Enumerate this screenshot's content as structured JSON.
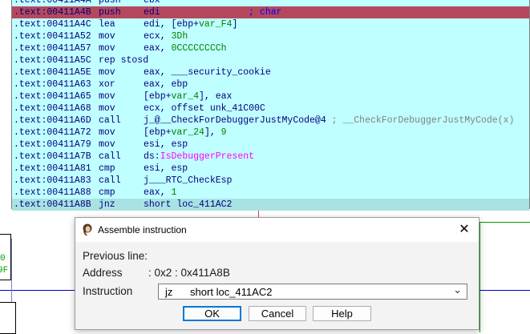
{
  "code": {
    "lines": [
      {
        "addr": ".text:00411A4A",
        "mn": "push",
        "ops": "ebx",
        "comment": "",
        "state": "normal"
      },
      {
        "addr": ".text:00411A4B",
        "mn": "push",
        "ops": "edi",
        "comment": "; char",
        "state": "selected"
      },
      {
        "addr": ".text:00411A4C",
        "mn": "lea",
        "ops_pre": "edi, [ebp+",
        "ops_var": "var_F4",
        "ops_post": "]",
        "state": "normal",
        "kind": "var"
      },
      {
        "addr": ".text:00411A52",
        "mn": "mov",
        "ops_pre": "ecx, ",
        "ops_imm": "3Dh",
        "state": "normal",
        "kind": "imm"
      },
      {
        "addr": ".text:00411A57",
        "mn": "mov",
        "ops_pre": "eax, ",
        "ops_imm": "0CCCCCCCCh",
        "state": "normal",
        "kind": "imm"
      },
      {
        "addr": ".text:00411A5C",
        "mn": "rep stosd",
        "ops": "",
        "state": "normal"
      },
      {
        "addr": ".text:00411A5E",
        "mn": "mov",
        "ops": "eax, ___security_cookie",
        "state": "normal"
      },
      {
        "addr": ".text:00411A63",
        "mn": "xor",
        "ops": "eax, ebp",
        "state": "normal"
      },
      {
        "addr": ".text:00411A65",
        "mn": "mov",
        "ops_pre": "[ebp+",
        "ops_var": "var_4",
        "ops_post": "], eax",
        "state": "normal",
        "kind": "var"
      },
      {
        "addr": ".text:00411A68",
        "mn": "mov",
        "ops": "ecx, offset unk_41C00C",
        "state": "normal"
      },
      {
        "addr": ".text:00411A6D",
        "mn": "call",
        "ops": "j_@__CheckForDebuggerJustMyCode@4",
        "comment": "; __CheckForDebuggerJustMyCode(x)",
        "state": "normal"
      },
      {
        "addr": ".text:00411A72",
        "mn": "mov",
        "ops_pre": "[ebp+",
        "ops_var": "var_24",
        "ops_post": "], ",
        "ops_imm": "9",
        "state": "normal",
        "kind": "varimm"
      },
      {
        "addr": ".text:00411A79",
        "mn": "mov",
        "ops": "esi, esp",
        "state": "normal"
      },
      {
        "addr": ".text:00411A7B",
        "mn": "call",
        "ops_pre": "ds:",
        "ops_fn": "IsDebuggerPresent",
        "state": "normal",
        "kind": "fn"
      },
      {
        "addr": ".text:00411A81",
        "mn": "cmp",
        "ops": "esi, esp",
        "state": "normal"
      },
      {
        "addr": ".text:00411A83",
        "mn": "call",
        "ops": "j___RTC_CheckEsp",
        "state": "normal"
      },
      {
        "addr": ".text:00411A88",
        "mn": "cmp",
        "ops_pre": "eax, ",
        "ops_imm": "1",
        "state": "normal",
        "kind": "imm"
      },
      {
        "addr": ".text:00411A8B",
        "mn": "jnz",
        "ops": "short loc_411AC2",
        "state": "current"
      }
    ]
  },
  "graph_frag": {
    "left_node_top_text": "0",
    "left_node_bottom_text": "9F"
  },
  "dialog": {
    "title": "Assemble instruction",
    "close_glyph": "✕",
    "previous_line_label": "Previous line:",
    "address_label": "Address",
    "address_value": ":  0x2  :  0x411A8B",
    "instruction_label": "Instruction",
    "instruction_value": "jz      short loc_411AC2",
    "dropdown_glyph": "⌄",
    "ok_label": "OK",
    "cancel_label": "Cancel",
    "help_label": "Help"
  },
  "colors": {
    "code_bg": "#c0ffff",
    "selected_line": "#b5485d",
    "current_line": "#a9e2e2",
    "address_color": "#00007f"
  }
}
